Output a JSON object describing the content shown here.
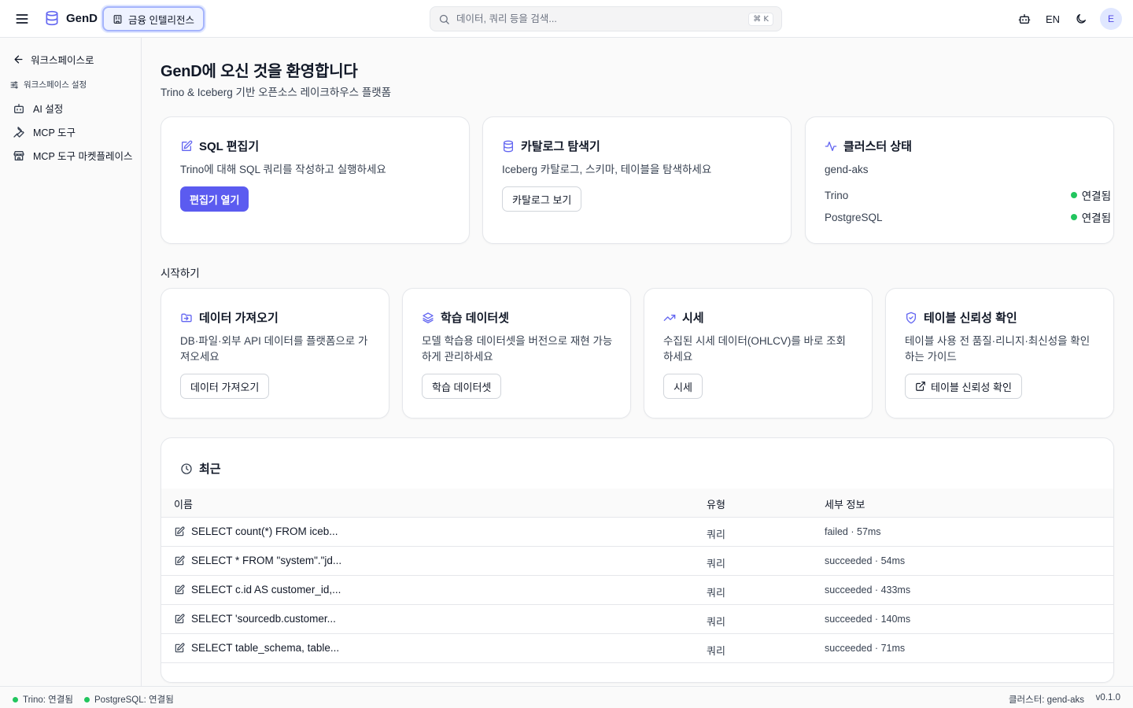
{
  "topbar": {
    "brand": "GenD",
    "domain": "금융 인텔리전스",
    "search_placeholder": "데이터, 쿼리 등을 검색...",
    "search_shortcut": "⌘ K",
    "lang": "EN",
    "avatar": "E"
  },
  "sidebar": {
    "back": "워크스페이스로",
    "section": "워크스페이스 설정",
    "items": [
      {
        "label": "AI 설정",
        "icon": "bot-icon"
      },
      {
        "label": "MCP 도구",
        "icon": "wrench-icon"
      },
      {
        "label": "MCP 도구 마켓플레이스",
        "icon": "store-icon"
      }
    ]
  },
  "main": {
    "title": "GenD에 오신 것을 환영합니다",
    "subtitle": "Trino & Iceberg 기반 오픈소스 레이크하우스 플랫폼",
    "cards": {
      "sql": {
        "title": "SQL 편집기",
        "desc": "Trino에 대해 SQL 쿼리를 작성하고 실행하세요",
        "button": "편집기 열기"
      },
      "catalog": {
        "title": "카탈로그 탐색기",
        "desc": "Iceberg 카탈로그, 스키마, 테이블을 탐색하세요",
        "button": "카탈로그 보기"
      },
      "cluster": {
        "title": "클러스터 상태",
        "name": "gend-aks",
        "rows": [
          {
            "label": "Trino",
            "status": "연결됨"
          },
          {
            "label": "PostgreSQL",
            "status": "연결됨"
          }
        ]
      }
    },
    "getting_started_label": "시작하기",
    "getting_started": [
      {
        "title": "데이터 가져오기",
        "desc1": "DB·파일·외부 API 데이터를 플랫폼으로 가",
        "desc2": "져오세요",
        "button": "데이터 가져오기"
      },
      {
        "title": "학습 데이터셋",
        "desc1": "모델 학습용 데이터셋을 버전으로 재현 가능",
        "desc2": "하게 관리하세요",
        "button": "학습 데이터셋"
      },
      {
        "title": "시세",
        "desc1": "수집된 시세 데이터(OHLCV)를 바로 조회",
        "desc2": "하세요",
        "button": "시세"
      },
      {
        "title": "테이블 신뢰성 확인",
        "desc1": "테이블 사용 전 품질·리니지·최신성을 확인",
        "desc2": "하는 가이드",
        "button": "테이블 신뢰성 확인"
      }
    ],
    "recent": {
      "title": "최근",
      "columns": [
        "이름",
        "유형",
        "세부 정보"
      ],
      "rows": [
        {
          "name": "SELECT count(*) FROM iceb...",
          "type": "쿼리",
          "detail": "failed · 57ms"
        },
        {
          "name": "SELECT * FROM \"system\".\"jd...",
          "type": "쿼리",
          "detail": "succeeded · 54ms"
        },
        {
          "name": "SELECT c.id AS customer_id,...",
          "type": "쿼리",
          "detail": "succeeded · 433ms"
        },
        {
          "name": "SELECT 'sourcedb.customer...",
          "type": "쿼리",
          "detail": "succeeded · 140ms"
        },
        {
          "name": "SELECT table_schema, table...",
          "type": "쿼리",
          "detail": "succeeded · 71ms"
        }
      ]
    }
  },
  "footer": {
    "trino": "Trino: 연결됨",
    "postgres": "PostgreSQL: 연결됨",
    "cluster": "클러스터: gend-aks",
    "version": "v0.1.0"
  },
  "colors": {
    "accent": "#5b5bf0",
    "icon_accent": "#6366f1",
    "connected": "#22c55e"
  }
}
